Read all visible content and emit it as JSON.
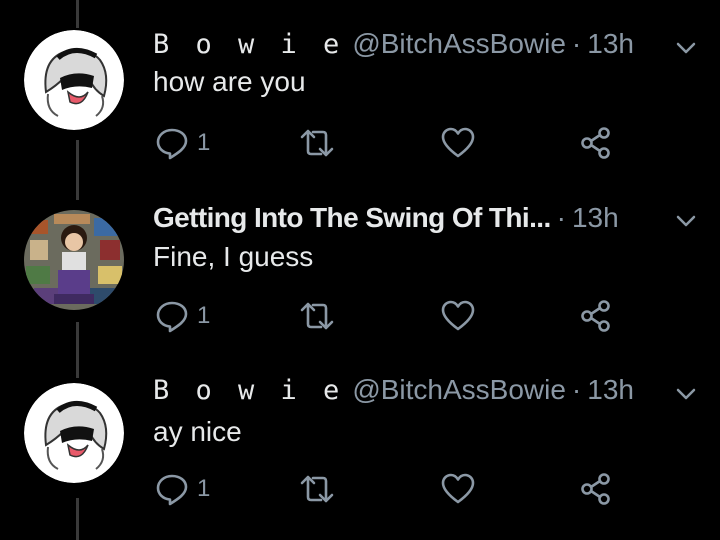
{
  "tweets": [
    {
      "display_name": "B o w i e",
      "handle": "@BitchAssBowie",
      "separator": "·",
      "time": "13h",
      "text": "how are you",
      "reply_count": "1",
      "avatar_icon": "anime-girl-avatar-icon"
    },
    {
      "display_name": "Getting Into The Swing Of Thi...",
      "handle": "",
      "separator": "·",
      "time": "13h",
      "text": "Fine, I guess",
      "reply_count": "1",
      "avatar_icon": "collage-avatar-icon"
    },
    {
      "display_name": "B o w i e",
      "handle": "@BitchAssBowie",
      "separator": "·",
      "time": "13h",
      "text": "ay nice",
      "reply_count": "1",
      "avatar_icon": "anime-girl-avatar-icon"
    }
  ],
  "icons": {
    "reply": "reply-icon",
    "retweet": "retweet-icon",
    "like": "heart-icon",
    "share": "share-icon",
    "menu": "chevron-down-icon"
  },
  "colors": {
    "background": "#000000",
    "text": "#e7e9ea",
    "secondary": "#8b98a5",
    "thread_line": "#3a3a3a"
  }
}
